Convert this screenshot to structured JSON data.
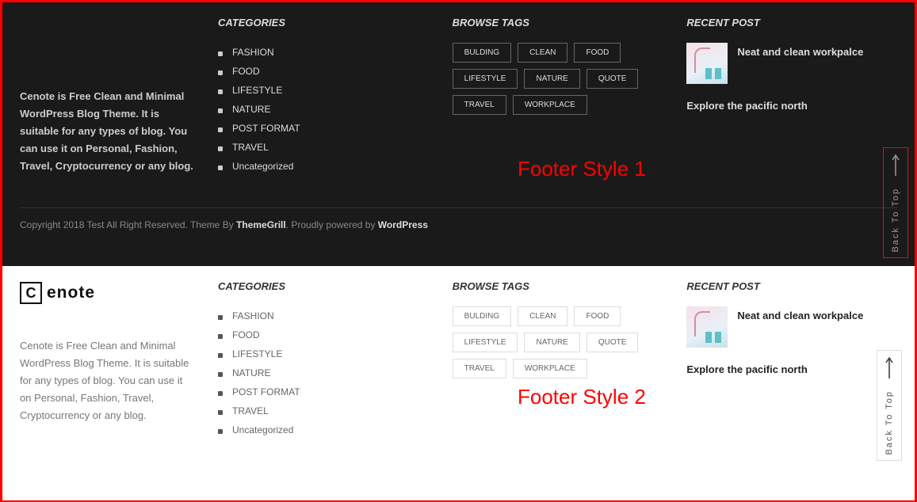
{
  "labels": {
    "style1": "Footer Style 1",
    "style2": "Footer Style 2",
    "backToTop": "Back To Top"
  },
  "brand": {
    "logoLetter": "C",
    "logoText": "enote"
  },
  "about": {
    "text": "Cenote is Free Clean and Minimal WordPress Blog Theme. It is suitable for any types of blog. You can use it on Personal, Fashion, Travel, Cryptocurrency  or any blog."
  },
  "headings": {
    "categories": "CATEGORIES",
    "browseTags": "BROWSE TAGS",
    "recentPost": "RECENT POST"
  },
  "categories": [
    "FASHION",
    "FOOD",
    "LIFESTYLE",
    "NATURE",
    "POST FORMAT",
    "TRAVEL",
    "Uncategorized"
  ],
  "tags": [
    "BULDING",
    "CLEAN",
    "FOOD",
    "LIFESTYLE",
    "NATURE",
    "QUOTE",
    "TRAVEL",
    "WORKPLACE"
  ],
  "recent": {
    "post1_title": "Neat and clean workpalce",
    "post2_title": "Explore the pacific north"
  },
  "copyright": {
    "prefix": "Copyright 2018 Test All Right Reserved. Theme By ",
    "theme_author": "ThemeGrill",
    "middle": ". Proudly powered by ",
    "platform": "WordPress"
  }
}
